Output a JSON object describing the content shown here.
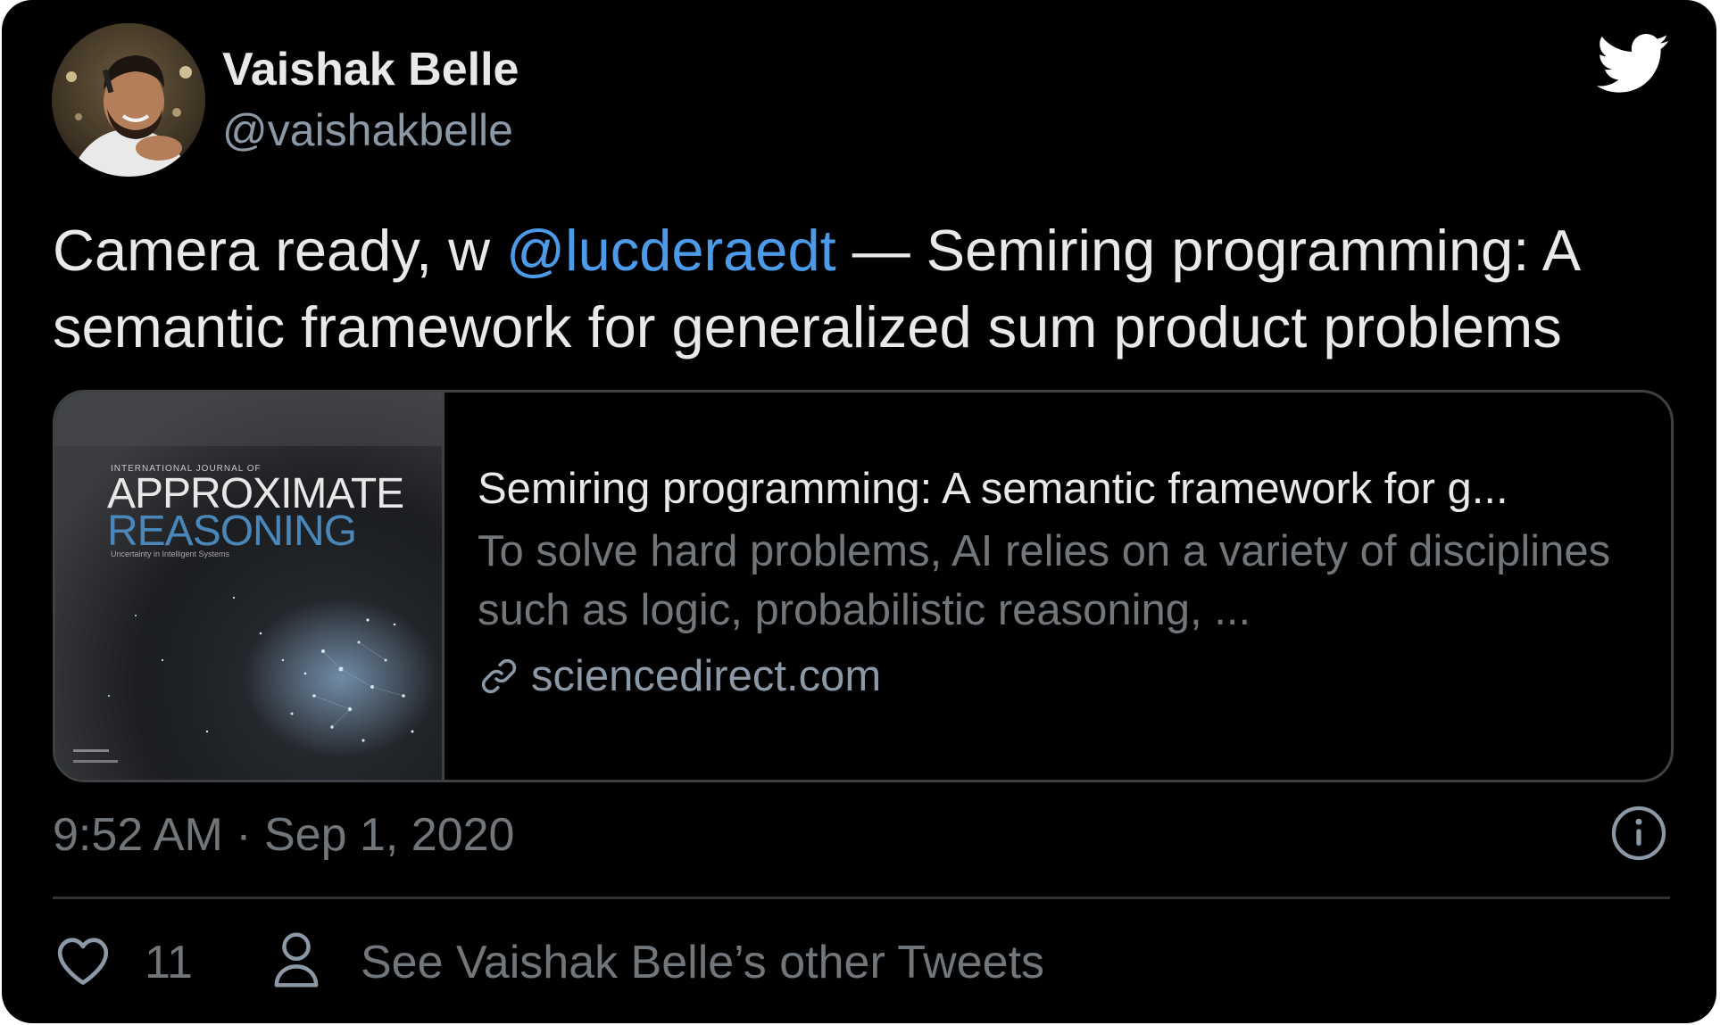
{
  "author": {
    "name": "Vaishak Belle",
    "handle": "@vaishakbelle"
  },
  "tweet": {
    "text_before": "Camera ready, w ",
    "mention": "@lucderaedt",
    "text_after": " — Semiring programming: A semantic framework for generalized sum product problems"
  },
  "link_card": {
    "title": "Semiring programming: A semantic framework for g...",
    "description": "To solve hard problems, AI relies on a variety of disciplines such as logic, probabilistic reasoning, ...",
    "domain": "sciencedirect.com",
    "thumbnail": {
      "journal_small": "INTERNATIONAL JOURNAL OF",
      "word1": "APPROXIMATE",
      "word2": "REASONING",
      "subtitle": "Uncertainty in Intelligent Systems"
    }
  },
  "timestamp": "9:52 AM · Sep 1, 2020",
  "actions": {
    "like_count": "11",
    "other_tweets_label": "See Vaishak Belle’s other Tweets"
  },
  "icons": {
    "brand": "twitter-bird-icon",
    "info": "info-icon",
    "like": "heart-icon",
    "profile": "person-icon",
    "link": "link-icon"
  },
  "colors": {
    "background": "#000000",
    "text_primary": "#e7e9ea",
    "text_secondary": "#71767b",
    "mention": "#4c9be8",
    "border": "#3e4144"
  }
}
